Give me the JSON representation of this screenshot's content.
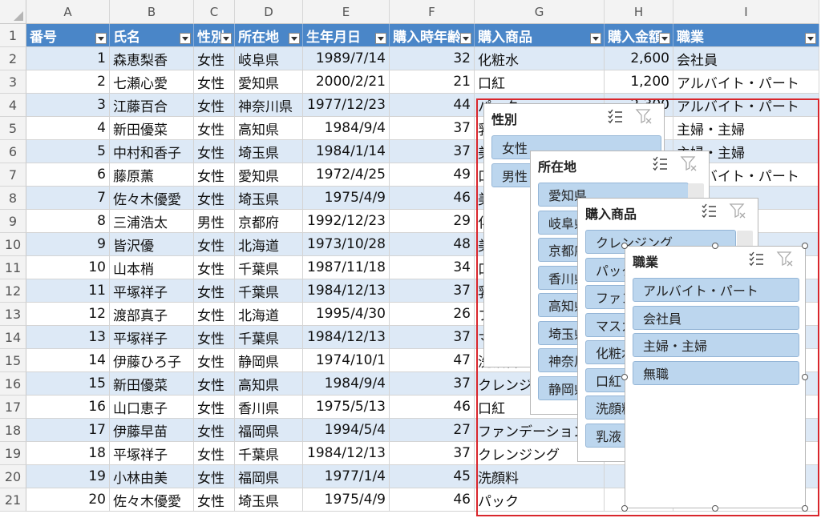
{
  "columns": [
    "A",
    "B",
    "C",
    "D",
    "E",
    "F",
    "G",
    "H",
    "I"
  ],
  "headers": [
    "番号",
    "氏名",
    "性別",
    "所在地",
    "生年月日",
    "購入時年齢",
    "購入商品",
    "購入金額",
    "職業"
  ],
  "rows": [
    [
      "1",
      "森恵梨香",
      "女性",
      "岐阜県",
      "1989/7/14",
      "32",
      "化粧水",
      "2,600",
      "会社員"
    ],
    [
      "2",
      "七瀬心愛",
      "女性",
      "愛知県",
      "2000/2/21",
      "21",
      "口紅",
      "1,200",
      "アルバイト・パート"
    ],
    [
      "3",
      "江藤百合",
      "女性",
      "神奈川県",
      "1977/12/23",
      "44",
      "パック",
      "2,300",
      "アルバイト・パート"
    ],
    [
      "4",
      "新田優菜",
      "女性",
      "高知県",
      "1984/9/4",
      "37",
      "乳液",
      "",
      "主婦・主婦"
    ],
    [
      "5",
      "中村和香子",
      "女性",
      "埼玉県",
      "1984/1/14",
      "37",
      "美容液",
      "",
      "主婦・主婦"
    ],
    [
      "6",
      "藤原薫",
      "女性",
      "愛知県",
      "1972/4/25",
      "49",
      "口紅",
      "",
      "アルバイト・パート"
    ],
    [
      "7",
      "佐々木優愛",
      "女性",
      "埼玉県",
      "1975/4/9",
      "46",
      "美容液",
      "",
      ""
    ],
    [
      "8",
      "三浦浩太",
      "男性",
      "京都府",
      "1992/12/23",
      "29",
      "化粧水",
      "",
      ""
    ],
    [
      "9",
      "皆沢優",
      "女性",
      "北海道",
      "1973/10/28",
      "48",
      "美容液",
      "",
      ""
    ],
    [
      "10",
      "山本梢",
      "女性",
      "千葉県",
      "1987/11/18",
      "34",
      "口紅",
      "",
      ""
    ],
    [
      "11",
      "平塚祥子",
      "女性",
      "千葉県",
      "1984/12/13",
      "37",
      "乳液",
      "",
      ""
    ],
    [
      "12",
      "渡部真子",
      "女性",
      "北海道",
      "1995/4/30",
      "26",
      "ファンデーション",
      "",
      ""
    ],
    [
      "13",
      "平塚祥子",
      "女性",
      "千葉県",
      "1984/12/13",
      "37",
      "マスカラ",
      "",
      ""
    ],
    [
      "14",
      "伊藤ひろ子",
      "女性",
      "静岡県",
      "1974/10/1",
      "47",
      "洗顔料",
      "",
      ""
    ],
    [
      "15",
      "新田優菜",
      "女性",
      "高知県",
      "1984/9/4",
      "37",
      "クレンジング",
      "",
      ""
    ],
    [
      "16",
      "山口恵子",
      "女性",
      "香川県",
      "1975/5/13",
      "46",
      "口紅",
      "",
      ""
    ],
    [
      "17",
      "伊藤早苗",
      "女性",
      "福岡県",
      "1994/5/4",
      "27",
      "ファンデーション",
      "",
      ""
    ],
    [
      "18",
      "平塚祥子",
      "女性",
      "千葉県",
      "1984/12/13",
      "37",
      "クレンジング",
      "",
      ""
    ],
    [
      "19",
      "小林由美",
      "女性",
      "福岡県",
      "1977/1/4",
      "45",
      "洗顔料",
      "",
      ""
    ],
    [
      "20",
      "佐々木優愛",
      "女性",
      "埼玉県",
      "1975/4/9",
      "46",
      "パック",
      "",
      ""
    ]
  ],
  "row_numbers": [
    "1",
    "2",
    "3",
    "4",
    "5",
    "6",
    "7",
    "8",
    "9",
    "10",
    "11",
    "12",
    "13",
    "14",
    "15",
    "16",
    "17",
    "18",
    "19",
    "20",
    "21"
  ],
  "slicers": [
    {
      "title": "性別",
      "items": [
        "女性",
        "男性"
      ]
    },
    {
      "title": "所在地",
      "items": [
        "愛知県",
        "岐阜県",
        "京都府",
        "香川県",
        "高知県",
        "埼玉県",
        "神奈川県",
        "静岡県"
      ]
    },
    {
      "title": "購入商品",
      "items": [
        "クレンジング",
        "パック",
        "ファンデーション",
        "マスカラ",
        "化粧水",
        "口紅",
        "洗顔料",
        "乳液"
      ]
    },
    {
      "title": "職業",
      "items": [
        "アルバイト・パート",
        "会社員",
        "主婦・主婦",
        "無職"
      ]
    }
  ],
  "icons": {
    "multi_select": "multi-select-icon",
    "clear_filter": "clear-filter-icon",
    "filter_dropdown": "filter-dropdown-icon"
  },
  "colors": {
    "header_fill": "#4a86c8",
    "band_fill": "#dde9f6",
    "item_fill": "#bcd6ee",
    "highlight_border": "#d9262c"
  }
}
